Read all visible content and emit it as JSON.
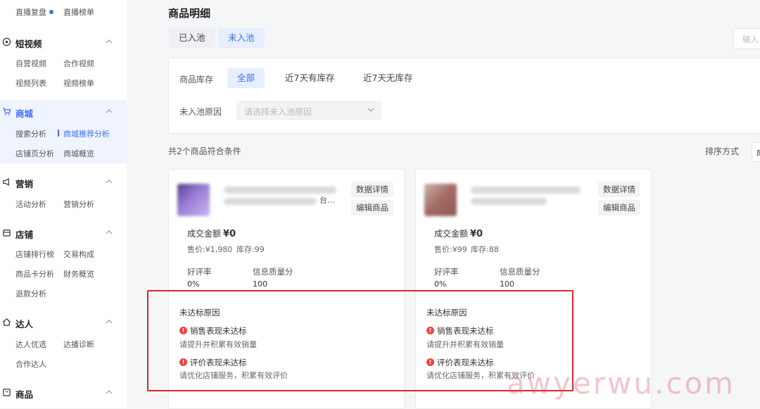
{
  "sidebar": {
    "top_items": [
      "直播复盘",
      "直播榜单"
    ],
    "sections": [
      {
        "title": "短视频",
        "icon": "circle-target-icon",
        "items": [
          "自营视频",
          "合作视频",
          "视频列表",
          "视频榜单"
        ]
      },
      {
        "title": "商城",
        "icon": "cart-icon",
        "active": true,
        "items": [
          "搜索分析",
          "商城推荐分析",
          "店铺页分析",
          "商城概览"
        ]
      },
      {
        "title": "营销",
        "icon": "megaphone-icon",
        "items": [
          "活动分析",
          "营销分析"
        ]
      },
      {
        "title": "店铺",
        "icon": "store-icon",
        "items": [
          "店铺排行榜",
          "交易构成",
          "商品卡分析",
          "财务概览",
          "退款分析"
        ]
      },
      {
        "title": "达人",
        "icon": "home-user-icon",
        "items": [
          "达人优选",
          "达播诊断",
          "合作达人"
        ]
      },
      {
        "title": "商品",
        "icon": "box-icon",
        "items": []
      }
    ],
    "accent_color": "#3b6cff"
  },
  "main": {
    "title": "商品明细",
    "tabs": [
      "已入池",
      "未入池"
    ],
    "active_tab": "未入池",
    "search_placeholder": "输入",
    "filters": {
      "stock_label": "商品库存",
      "stock_options": [
        "全部",
        "近7天有库存",
        "近7天无库存"
      ],
      "stock_selected": "全部",
      "reason_label": "未入池原因",
      "reason_placeholder": "请选择未入池原因"
    },
    "result_count_text": "共2个商品符合条件",
    "sort_label": "排序方式",
    "sort_value_partial": "成"
  },
  "products": [
    {
      "title_suffix": "台…",
      "buttons": [
        "数据详情",
        "编辑商品"
      ],
      "amount_label": "成交金额",
      "amount_value": "¥0",
      "price_text": "售价:¥1,980",
      "stock_text": "库存:99",
      "metrics": [
        {
          "label": "好评率",
          "value": "0%"
        },
        {
          "label": "信息质量分",
          "value": "100"
        }
      ],
      "reason_title": "未达标原因",
      "reasons": [
        {
          "heading": "销售表现未达标",
          "detail": "请提升并积累有效销量"
        },
        {
          "heading": "评价表现未达标",
          "detail": "请优化店铺服务，积累有效评价"
        }
      ]
    },
    {
      "title_suffix": "",
      "buttons": [
        "数据详情",
        "编辑商品"
      ],
      "amount_label": "成交金额",
      "amount_value": "¥0",
      "price_text": "售价:¥99",
      "stock_text": "库存:88",
      "metrics": [
        {
          "label": "好评率",
          "value": "0%"
        },
        {
          "label": "信息质量分",
          "value": "100"
        }
      ],
      "reason_title": "未达标原因",
      "reasons": [
        {
          "heading": "销售表现未达标",
          "detail": "请提升并积累有效销量"
        },
        {
          "heading": "评价表现未达标",
          "detail": "请优化店铺服务，积累有效评价"
        }
      ]
    }
  ],
  "watermark": "awyerwu.com",
  "colors": {
    "warn": "#f04343",
    "highlight_frame": "#d7262b"
  }
}
